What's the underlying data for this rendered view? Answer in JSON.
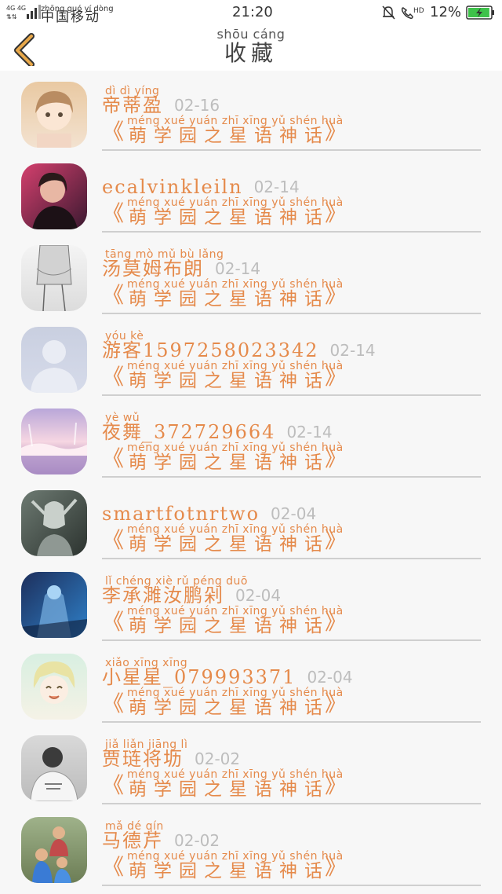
{
  "status_bar": {
    "network": "4G 4G",
    "carrier_pinyin": "zhōng guó yí dòng",
    "carrier": "中国移动",
    "time": "21:20",
    "hd": "HD",
    "battery": "12%",
    "battery_level": 0.12
  },
  "header": {
    "title_pinyin": "shōu cáng",
    "title": "收藏",
    "back_icon": "chevron-left-icon",
    "accent": "#e8a84a"
  },
  "colors": {
    "accent": "#e58a4b",
    "date": "#bdbdbd",
    "divider": "#cfcfcf",
    "background": "#f7f7f7"
  },
  "items": [
    {
      "name_pinyin": "dì dì yíng",
      "name": "帝蒂盈",
      "date": "02-16",
      "book_pinyin": "méng xué yuán zhī xīng yǔ shén huà",
      "book": "萌学园之星语神话"
    },
    {
      "name_pinyin": "",
      "name": "ecalvinkleiln",
      "date": "02-14",
      "book_pinyin": "méng xué yuán zhī xīng yǔ shén huà",
      "book": "萌学园之星语神话"
    },
    {
      "name_pinyin": "tāng mò mǔ bù lǎng",
      "name": "汤莫姆布朗",
      "date": "02-14",
      "book_pinyin": "méng xué yuán zhī xīng yǔ shén huà",
      "book": "萌学园之星语神话"
    },
    {
      "name_pinyin": "yóu kè",
      "name": "游客1597258023342",
      "date": "02-14",
      "book_pinyin": "méng xué yuán zhī xīng yǔ shén huà",
      "book": "萌学园之星语神话"
    },
    {
      "name_pinyin": "yè wǔ",
      "name": "夜舞_372729664",
      "date": "02-14",
      "book_pinyin": "méng xué yuán zhī xīng yǔ shén huà",
      "book": "萌学园之星语神话"
    },
    {
      "name_pinyin": "",
      "name": "smartfotnrtwo",
      "date": "02-04",
      "book_pinyin": "méng xué yuán zhī xīng yǔ shén huà",
      "book": "萌学园之星语神话"
    },
    {
      "name_pinyin": "lǐ chéng xiè rǔ péng duō",
      "name": "李承濉汝鹏剁",
      "date": "02-04",
      "book_pinyin": "méng xué yuán zhī xīng yǔ shén huà",
      "book": "萌学园之星语神话"
    },
    {
      "name_pinyin": "xiǎo xīng xīng",
      "name": "小星星_079993371",
      "date": "02-04",
      "book_pinyin": "méng xué yuán zhī xīng yǔ shén huà",
      "book": "萌学园之星语神话"
    },
    {
      "name_pinyin": "jiǎ liǎn jiāng lì",
      "name": "贾琏将坜",
      "date": "02-02",
      "book_pinyin": "méng xué yuán zhī xīng yǔ shén huà",
      "book": "萌学园之星语神话"
    },
    {
      "name_pinyin": "mǎ dé qín",
      "name": "马德芹",
      "date": "02-02",
      "book_pinyin": "méng xué yuán zhī xīng yǔ shén huà",
      "book": "萌学园之星语神话"
    }
  ],
  "book_open": "《",
  "book_close": "》"
}
